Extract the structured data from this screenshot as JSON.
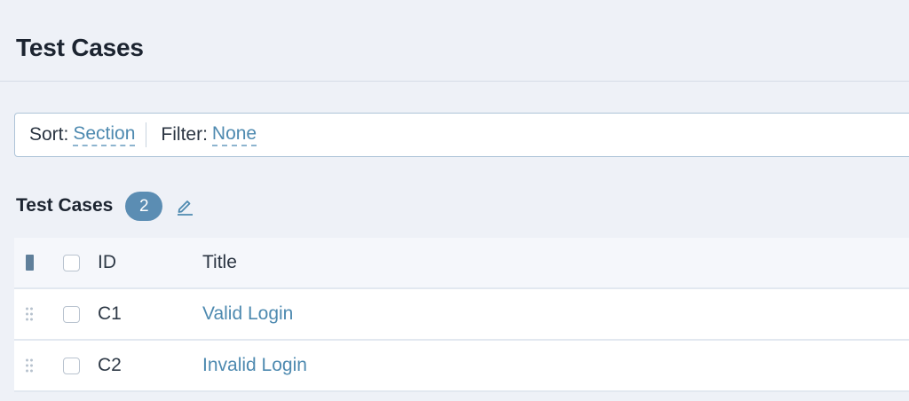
{
  "page": {
    "title": "Test Cases"
  },
  "toolbar": {
    "sort_label": "Sort:",
    "sort_value": "Section",
    "filter_label": "Filter:",
    "filter_value": "None"
  },
  "section": {
    "title": "Test Cases",
    "count": "2"
  },
  "table": {
    "columns": {
      "id": "ID",
      "title": "Title"
    },
    "rows": [
      {
        "id": "C1",
        "title": "Valid Login"
      },
      {
        "id": "C2",
        "title": "Invalid Login"
      }
    ]
  },
  "icons": {
    "edit": "pencil-icon",
    "drag": "drag-handle-icon",
    "columns": "column-toggle-icon"
  },
  "colors": {
    "accent": "#4e8ab0",
    "badge": "#5b8db3",
    "background": "#eef1f7"
  }
}
